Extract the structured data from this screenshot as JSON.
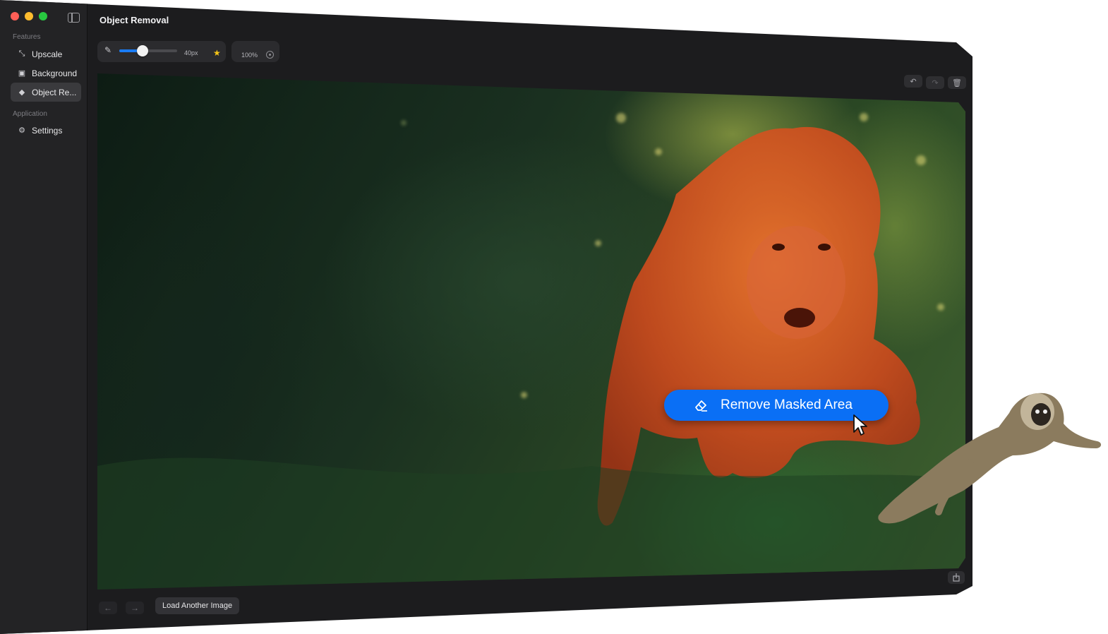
{
  "window": {
    "title": "Object Removal"
  },
  "sidebar": {
    "sections": [
      {
        "label": "Features"
      },
      {
        "label": "Application"
      }
    ],
    "items": [
      {
        "label": "Upscale",
        "icon": "upscale-icon",
        "active": false
      },
      {
        "label": "Background",
        "icon": "background-icon",
        "active": false
      },
      {
        "label": "Object Re...",
        "icon": "eraser-icon",
        "active": true
      },
      {
        "label": "Settings",
        "icon": "gear-icon",
        "active": false
      }
    ]
  },
  "toolbar": {
    "brush_size_label": "40px",
    "brush_size_value": 0.4,
    "zoom_label": "100%"
  },
  "canvas": {
    "action_button_label": "Remove Masked Area",
    "mask_color": "#e0421c"
  },
  "footer": {
    "load_button_label": "Load Another Image"
  },
  "colors": {
    "accent": "#0a6ff5",
    "window_bg": "#1c1c1e",
    "sidebar_bg": "#232325"
  }
}
